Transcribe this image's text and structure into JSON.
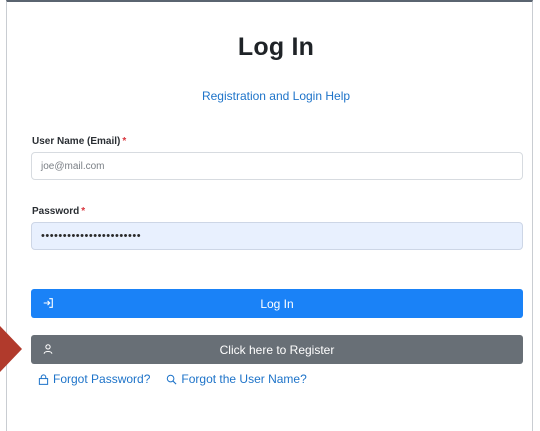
{
  "page": {
    "title": "Log In",
    "help_link": "Registration and Login Help"
  },
  "form": {
    "username_label": "User Name (Email)",
    "username_required": "*",
    "username_placeholder": "joe@mail.com",
    "password_label": "Password",
    "password_required": "*",
    "password_value": "•••••••••••••••••••••••"
  },
  "buttons": {
    "login_label": "Log In",
    "login_icon": "sign-in-icon",
    "register_label": "Click here to Register",
    "register_icon": "person-icon"
  },
  "links": {
    "forgot_password": "Forgot Password?",
    "forgot_password_icon": "lock-icon",
    "forgot_username": "Forgot the User Name?",
    "forgot_username_icon": "search-icon"
  },
  "colors": {
    "primary": "#1a82f7",
    "secondary": "#686f76",
    "link": "#1d73c9",
    "required": "#d9363e",
    "autofill": "#e8f0fe",
    "arrow": "#b13a2c"
  }
}
